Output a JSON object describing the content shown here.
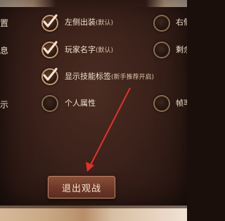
{
  "settings": {
    "rows": [
      {
        "label": "置",
        "left_option": {
          "checked": true,
          "label": "左侧出装",
          "sub": "(默认)"
        },
        "right_option": {
          "checked": false,
          "label": "右侧"
        }
      },
      {
        "label": "息",
        "left_option": {
          "checked": true,
          "label": "玩家名字",
          "sub": "(默认)"
        },
        "right_option": {
          "checked": false,
          "label": "剩余"
        }
      },
      {
        "label": "",
        "left_option": {
          "checked": true,
          "label": "显示技能标签",
          "sub": "(新手推荐开启)"
        },
        "right_option": null
      },
      {
        "label": "示",
        "left_option": {
          "checked": false,
          "label": "个人属性",
          "sub": ""
        },
        "right_option": {
          "checked": false,
          "label": "帧率"
        }
      }
    ]
  },
  "exit_button": {
    "label": "退出观战"
  },
  "annotation": {
    "arrow_color": "#e0322a"
  }
}
